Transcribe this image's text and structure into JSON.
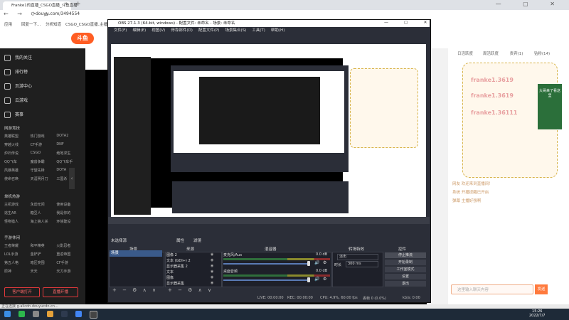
{
  "browser": {
    "tab_title": "Franke1的直播_CSGO直播_斗鱼直播",
    "tab_close": "×",
    "new_tab": "+",
    "window_controls": "—  ▢  ✕",
    "nav": "←  →  ⟳  ⌂",
    "url": "douyu.com/3494554",
    "bookmarks": [
      "应用",
      "回复一下...",
      "分析知道",
      "CSGO_CSGO直播..",
      "主播"
    ]
  },
  "douyu": {
    "logo": "斗鱼",
    "sidebar": {
      "items": [
        "我的关注",
        "排行榜",
        "页游中心",
        "云游戏",
        "赛事"
      ],
      "section_online": "网游竞技",
      "online_games": [
        "英雄联盟",
        "热门游戏",
        "DOTA2",
        "穿越火线",
        "CF手游",
        "DNF",
        "炉石传说",
        "CSGO",
        "绝地求生",
        "QQ飞车",
        "魔兽争霸",
        "QQ飞车手",
        "风暴英雄",
        "守望先锋",
        "DOTA",
        "使命召唤",
        "天涯明月刀",
        "三国杀"
      ],
      "section_mobile": "单机热游",
      "mobile_games": [
        "主机游戏",
        "永劫无间",
        "使用设备",
        "逃生AR",
        "糖豆人",
        "我是你的",
        "怪物猎人",
        "海上狼人杀",
        "环境建设"
      ],
      "section_fun": "手游休闲",
      "fun_games": [
        "王者荣耀",
        "和平精英",
        "火影忍者",
        "LOL手游",
        "金铲铲",
        "重返帝国",
        "第五人格",
        "暗区突围",
        "CF手游",
        "原神",
        "天天",
        "天刀手游"
      ],
      "btn_left": "客户端打开",
      "btn_right": "直播开播",
      "collapse": "‹"
    },
    "right_panel": {
      "tabs": [
        "日活跃度",
        "周活跃度",
        "贵宾(1)",
        "钻粉(14)"
      ],
      "tt_cards": [
        "franke1.3619",
        "franke1.3619",
        "franke1.36111"
      ],
      "dwp_label": "大哥来了看这里",
      "chat_lines": [
        "网友 欢迎来到直播间！",
        "系统 开播提醒已开启",
        "弹幕 主播好强啊"
      ],
      "chat_placeholder": "这里输入聊天内容",
      "send": "发送"
    }
  },
  "obs": {
    "title": "OBS 27.1.3 (64-bit, windows) - 配置文件: 未命名 - 场景: 未命名",
    "window_controls": "—  ▢  ✕",
    "menu": [
      "文件(F)",
      "编辑(E)",
      "视图(V)",
      "停靠部件(D)",
      "配置文件(P)",
      "场景集合(S)",
      "工具(T)",
      "帮助(H)"
    ],
    "docks": {
      "scenes_header": "场景",
      "sources_header": "来源",
      "mixer_header": "混音器",
      "transition_header": "转场特效",
      "controls_header": "控件",
      "no_source_selected": "未选择源",
      "props": "属性",
      "filters": "滤镜"
    },
    "scene_name": "场景",
    "sources": [
      "图像 2",
      "文本 (GDI+) 2",
      "显示器采集 2",
      "文本",
      "图像",
      "显示器采集"
    ],
    "mixer": [
      {
        "name": "麦克风/Aux",
        "db": "0.0 dB"
      },
      {
        "name": "桌面音频",
        "db": "0.0 dB"
      }
    ],
    "transition": {
      "type": "淡出",
      "duration_label": "时长",
      "duration": "300 ms"
    },
    "controls": [
      "停止推流",
      "开始录制",
      "工作室模式",
      "设置",
      "退出"
    ],
    "status": {
      "live": "LIVE: 00:00:00",
      "rec": "REC: 00:00:00",
      "cpu": "CPU: 4.9%, 60.00 fps",
      "dropped": "丢帧 0 (0.0%)",
      "kbps": "kb/s: 0.00"
    },
    "dock_buttons": "+ − ⚙ ∧ ∨"
  },
  "status_url": "正在连接 g.alicdn.douyucdn.cn...",
  "clock": {
    "time": "15:26",
    "date": "2022/7/7"
  },
  "colors": {
    "obs_bg": "#2b2e38",
    "douyu_orange": "#ff5d23",
    "accent_blue": "#3a5a8a"
  }
}
